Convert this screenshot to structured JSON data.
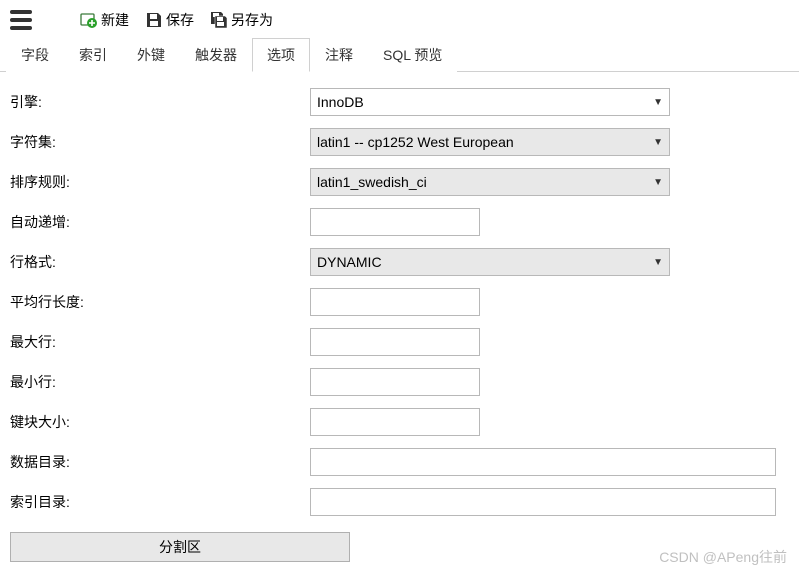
{
  "toolbar": {
    "new_label": "新建",
    "save_label": "保存",
    "saveas_label": "另存为"
  },
  "tabs": {
    "fields": "字段",
    "indexes": "索引",
    "fk": "外键",
    "triggers": "触发器",
    "options": "选项",
    "comment": "注释",
    "sqlpreview": "SQL 预览"
  },
  "form": {
    "labels": {
      "engine": "引擎:",
      "charset": "字符集:",
      "collation": "排序规则:",
      "autoinc": "自动递增:",
      "rowformat": "行格式:",
      "avgrowlen": "平均行长度:",
      "maxrows": "最大行:",
      "minrows": "最小行:",
      "keyblock": "键块大小:",
      "datadir": "数据目录:",
      "indexdir": "索引目录:"
    },
    "values": {
      "engine": "InnoDB",
      "charset": "latin1 -- cp1252 West European",
      "collation": "latin1_swedish_ci",
      "autoinc": "",
      "rowformat": "DYNAMIC",
      "avgrowlen": "",
      "maxrows": "",
      "minrows": "",
      "keyblock": "",
      "datadir": "",
      "indexdir": ""
    },
    "partition_btn": "分割区"
  },
  "watermark": "CSDN @APeng往前"
}
